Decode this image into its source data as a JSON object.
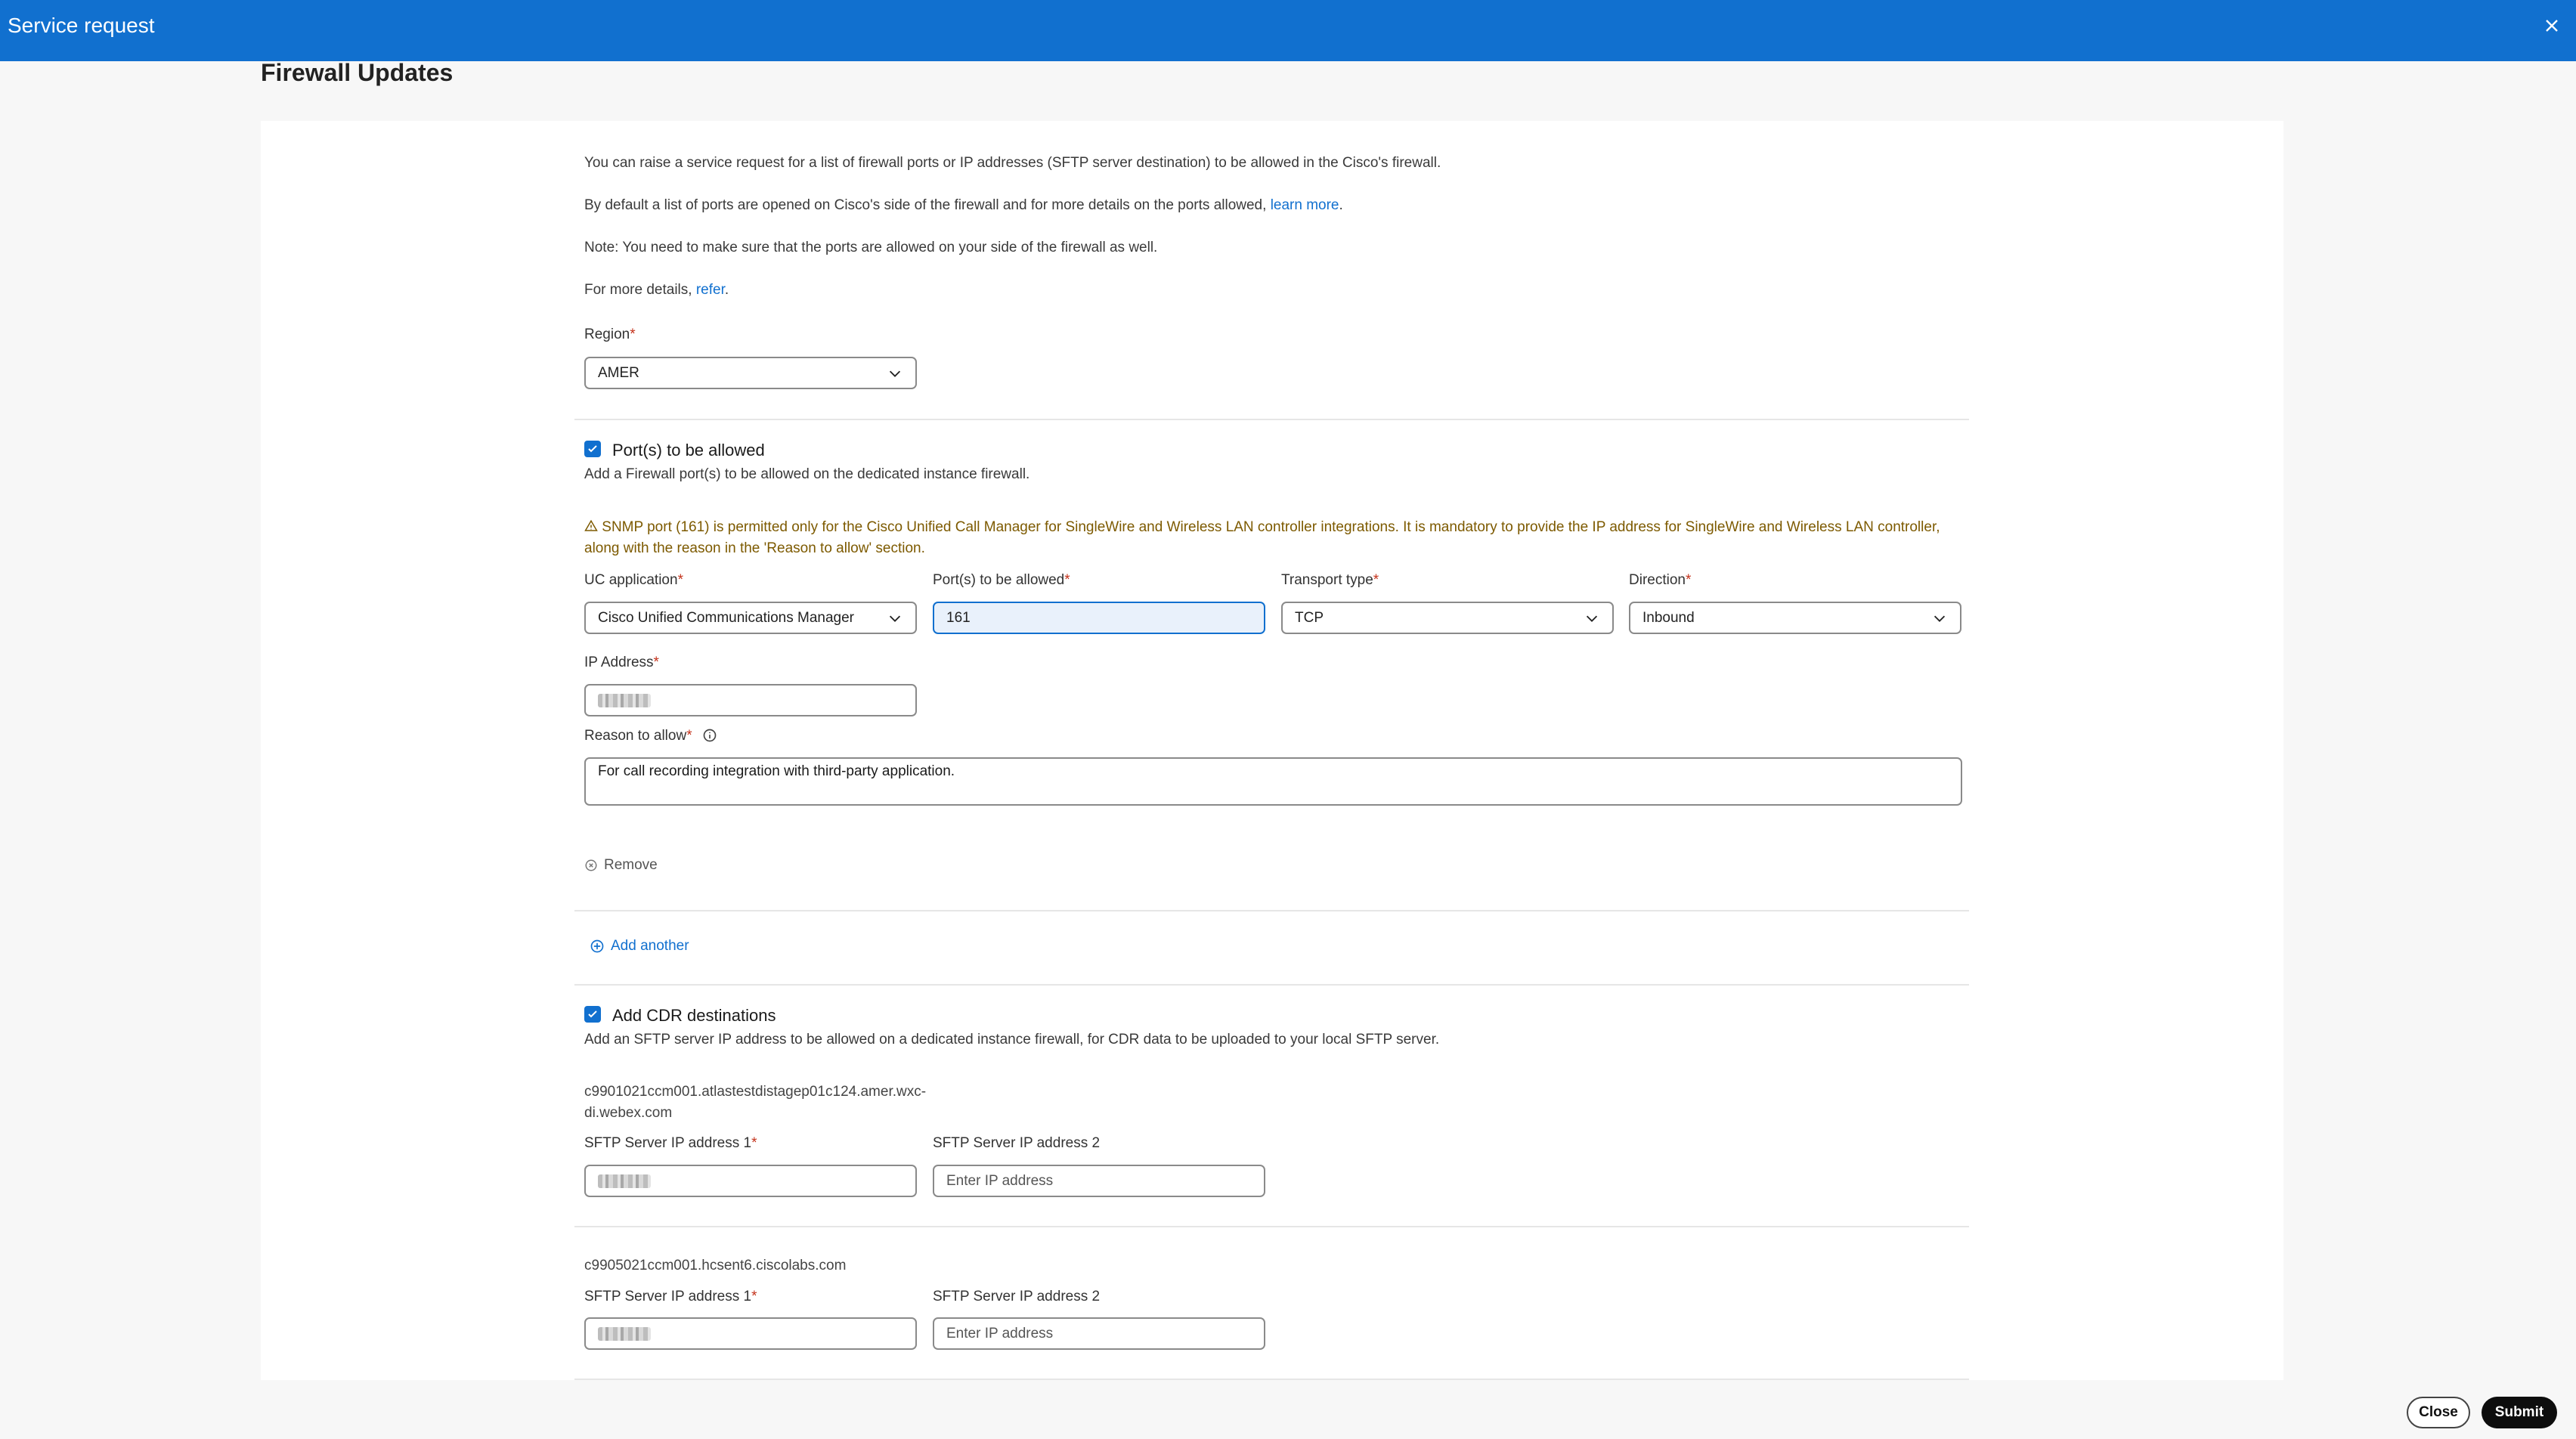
{
  "modal": {
    "title": "Service request",
    "close_icon": "close-icon"
  },
  "page_title": "Firewall Updates",
  "intro": {
    "p1": "You can raise a service request for a list of firewall ports or IP addresses (SFTP server destination) to be allowed in the Cisco's firewall.",
    "p2_text": "By default a list of ports are opened on Cisco's side of the firewall and for more details on the ports allowed, ",
    "p2_link": "learn more",
    "p2_end": ".",
    "p3": "Note: You need to make sure that the ports are allowed on your side of the firewall as well.",
    "p4_text": "For more details, ",
    "p4_link": "refer",
    "p4_end": "."
  },
  "region": {
    "label": "Region",
    "required": "*",
    "value": "AMER"
  },
  "ports_section": {
    "checked": true,
    "title": "Port(s) to be allowed",
    "description": "Add a Firewall port(s) to be allowed on the dedicated instance firewall.",
    "warning": "SNMP port (161) is permitted only for the Cisco Unified Call Manager for SingleWire and Wireless LAN controller integrations. It is mandatory to provide the IP address for SingleWire and Wireless LAN controller, along with the reason in the 'Reason to allow' section.",
    "uc_label": "UC application",
    "uc_value": "Cisco Unified Communications Manager",
    "ports_label": "Port(s) to be allowed",
    "ports_value": "161",
    "transport_label": "Transport type",
    "transport_value": "TCP",
    "direction_label": "Direction",
    "direction_value": "Inbound",
    "ip_label": "IP Address",
    "reason_label": "Reason to allow",
    "reason_value": "For call recording integration with third-party application.",
    "remove_label": "Remove",
    "add_another_label": "Add another",
    "required": "*"
  },
  "cdr_section": {
    "checked": true,
    "title": "Add CDR destinations",
    "description": "Add an SFTP server IP address to be allowed on a dedicated instance firewall, for CDR data to be uploaded to your local SFTP server.",
    "destinations": [
      {
        "host": "c9901021ccm001.atlastestdistagep01c124.amer.wxc-di.webex.com",
        "ip1_label": "SFTP Server IP address 1",
        "ip2_label": "SFTP Server IP address 2",
        "ip2_placeholder": "Enter IP address"
      },
      {
        "host": "c9905021ccm001.hcsent6.ciscolabs.com",
        "ip1_label": "SFTP Server IP address 1",
        "ip2_label": "SFTP Server IP address 2",
        "ip2_placeholder": "Enter IP address"
      }
    ],
    "required": "*"
  },
  "footer": {
    "close_label": "Close",
    "submit_label": "Submit"
  },
  "colors": {
    "header": "#1170cf",
    "link": "#1170cf",
    "warning": "#7d5a00"
  }
}
